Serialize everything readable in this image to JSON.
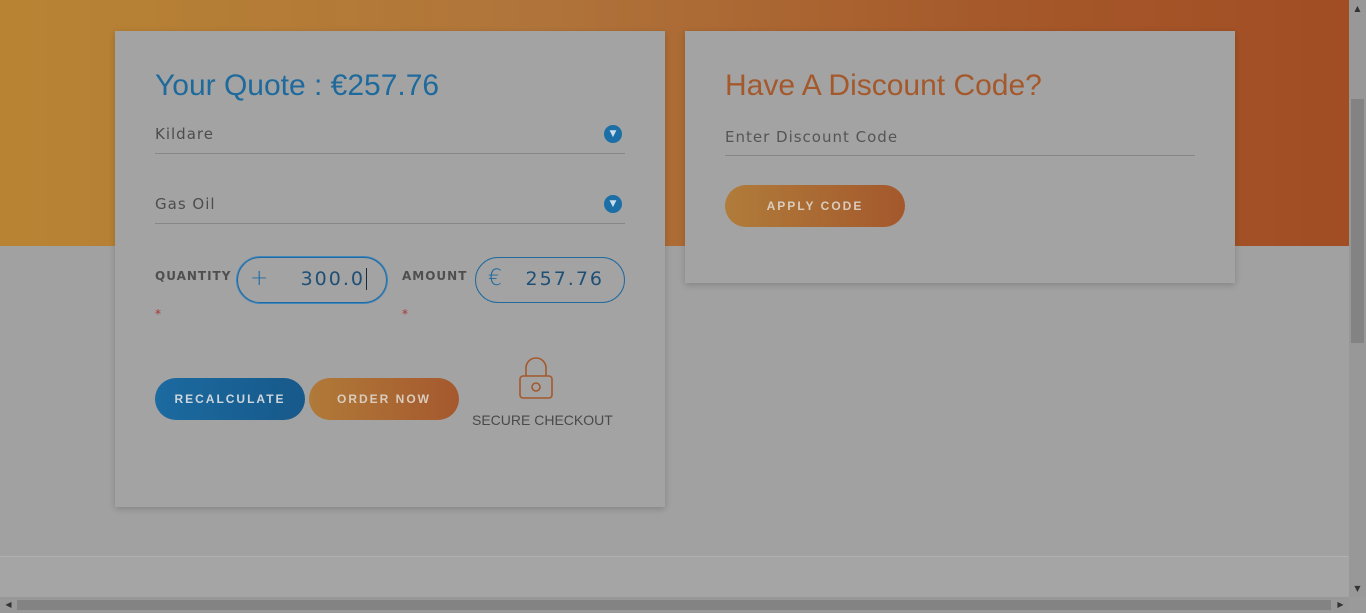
{
  "quote": {
    "title": "Your Quote : €257.76",
    "county": "Kildare",
    "fuel_type": "Gas Oil",
    "quantity_label": "QUANTITY",
    "quantity_value": "300.0",
    "quantity_prefix": "+",
    "amount_label": "AMOUNT",
    "amount_value": "257.76",
    "amount_prefix": "€",
    "required_mark": "*",
    "recalculate_label": "RECALCULATE",
    "order_label": "ORDER NOW",
    "secure_text": "SECURE CHECKOUT"
  },
  "discount": {
    "title": "Have A Discount Code?",
    "placeholder": "Enter Discount Code",
    "apply_label": "APPLY CODE"
  },
  "colors": {
    "primary_blue": "#1e6a9c",
    "accent_orange": "#a4592c"
  },
  "icons": {
    "dropdown": "chevron-down-icon",
    "lock": "lock-icon"
  }
}
